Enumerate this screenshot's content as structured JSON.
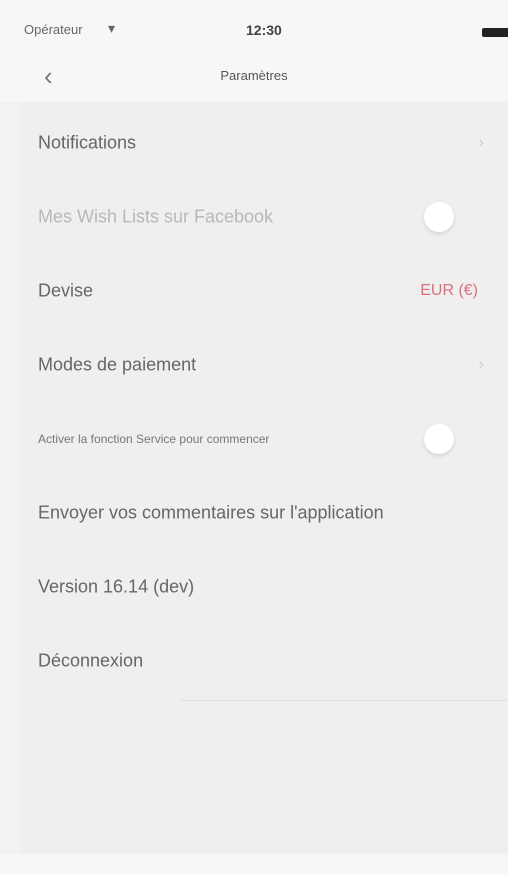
{
  "status_bar": {
    "carrier": "Opérateur",
    "wifi_icon": "wifi-icon",
    "time": "12:30",
    "battery_icon": "battery-icon"
  },
  "nav": {
    "back_icon": "chevron-left-icon",
    "title": "Paramètres"
  },
  "settings": {
    "notifications": "Notifications",
    "facebook_wishlists": "Mes Wish Lists sur Facebook",
    "currency_label": "Devise",
    "currency_value": "EUR (€)",
    "payment_modes": "Modes de paiement",
    "enable_service": "Activer la fonction Service pour commencer",
    "feedback": "Envoyer vos commentaires sur l'application",
    "version": "Version 16.14 (dev)",
    "logout": "Déconnexion"
  },
  "colors": {
    "accent": "#d9707a",
    "background": "#f2f2f2"
  }
}
